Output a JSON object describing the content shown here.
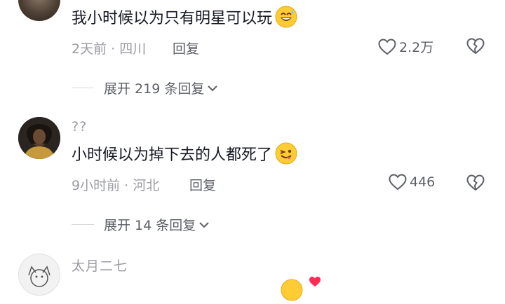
{
  "comments": [
    {
      "username": "",
      "text": "我小时候以为只有明星可以玩",
      "emoji": "grinning-sweat-emoji",
      "time": "2天前",
      "location": "四川",
      "reply_label": "回复",
      "likes": "2.2万",
      "expand_label": "展开 219 条回复"
    },
    {
      "username": "??",
      "text": "小时候以为掉下去的人都死了",
      "emoji": "winking-tongue-emoji",
      "time": "9小时前",
      "location": "河北",
      "reply_label": "回复",
      "likes": "446",
      "expand_label": "展开 14 条回复"
    },
    {
      "username": "太月二七",
      "text": "",
      "emoji": "smiling-emoji",
      "time": "",
      "location": "",
      "reply_label": "",
      "likes": "",
      "expand_label": ""
    }
  ],
  "separator": "·",
  "colors": {
    "primary_text": "#161823",
    "secondary_text": "#9a9ca3",
    "action_text": "#5c5f66",
    "emoji_yellow": "#ffcc33",
    "heart_red": "#fe2c55"
  }
}
